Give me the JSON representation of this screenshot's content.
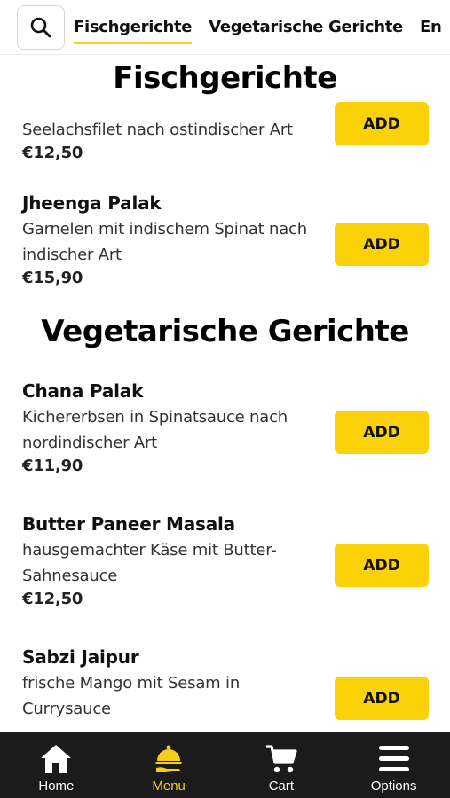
{
  "topbar": {
    "tabs": [
      {
        "label": "Fischgerichte",
        "active": true
      },
      {
        "label": "Vegetarische Gerichte",
        "active": false
      },
      {
        "label": "En",
        "active": false
      }
    ]
  },
  "sections": [
    {
      "title": "Fischgerichte",
      "items": [
        {
          "name": "",
          "desc": "Seelachsfilet nach ostindischer Art",
          "price": "€12,50",
          "add_label": "ADD"
        },
        {
          "name": "Jheenga Palak",
          "desc": "Garnelen mit indischem Spinat nach indischer Art",
          "price": "€15,90",
          "add_label": "ADD"
        }
      ]
    },
    {
      "title": "Vegetarische Gerichte",
      "items": [
        {
          "name": "Chana Palak",
          "desc": "Kichererbsen in Spinatsauce nach nordindischer Art",
          "price": "€11,90",
          "add_label": "ADD"
        },
        {
          "name": "Butter Paneer Masala",
          "desc": "hausgemachter Käse mit Butter-Sahnesauce",
          "price": "€12,50",
          "add_label": "ADD"
        },
        {
          "name": "Sabzi Jaipur",
          "desc": "frische Mango mit Sesam in Currysauce",
          "price": "",
          "add_label": "ADD"
        }
      ]
    }
  ],
  "bottom_nav": {
    "items": [
      {
        "label": "Home",
        "icon": "home-icon",
        "active": false
      },
      {
        "label": "Menu",
        "icon": "menu-cloche-icon",
        "active": true
      },
      {
        "label": "Cart",
        "icon": "cart-icon",
        "active": false
      },
      {
        "label": "Options",
        "icon": "hamburger-icon",
        "active": false
      }
    ]
  },
  "colors": {
    "accent": "#fbd208",
    "nav_bg": "#1b1b1b",
    "active_nav": "#f5cd1b"
  }
}
